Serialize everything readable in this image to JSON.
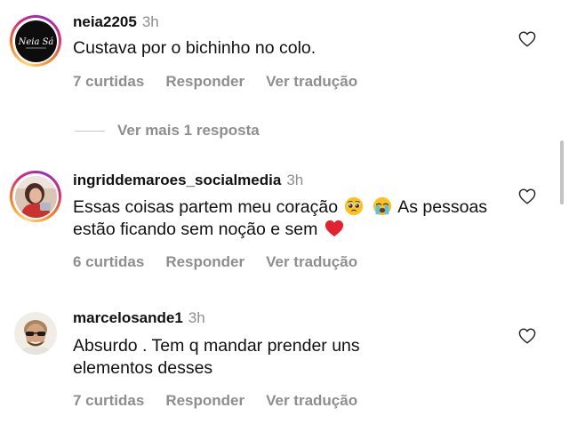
{
  "comments": [
    {
      "username": "neia2205",
      "time": "3h",
      "text": "Custava por o bichinho no colo.",
      "likes": "7 curtidas",
      "reply": "Responder",
      "translate": "Ver tradução",
      "avatar_logo_text": "Neia Sá"
    },
    {
      "username": "ingriddemaroes_socialmedia",
      "time": "3h",
      "text_part1": "Essas coisas partem meu coração",
      "text_part2": "As pessoas estão ficando sem noção e sem",
      "likes": "6 curtidas",
      "reply": "Responder",
      "translate": "Ver tradução"
    },
    {
      "username": "marcelosande1",
      "time": "3h",
      "text": "Absurdo . Tem q mandar prender uns elementos desses",
      "likes": "7 curtidas",
      "reply": "Responder",
      "translate": "Ver tradução"
    }
  ],
  "more_replies": "Ver mais 1 resposta",
  "icons": {
    "like": "heart-outline-icon",
    "emoji_pleading": "pleading-face-emoji",
    "emoji_crying": "loudly-crying-face-emoji",
    "emoji_heart": "red-heart-emoji"
  },
  "colors": {
    "secondary_text": "#8e8e8e",
    "story_ring": [
      "#feda75",
      "#fa7e1e",
      "#d62976",
      "#962fbf"
    ]
  }
}
